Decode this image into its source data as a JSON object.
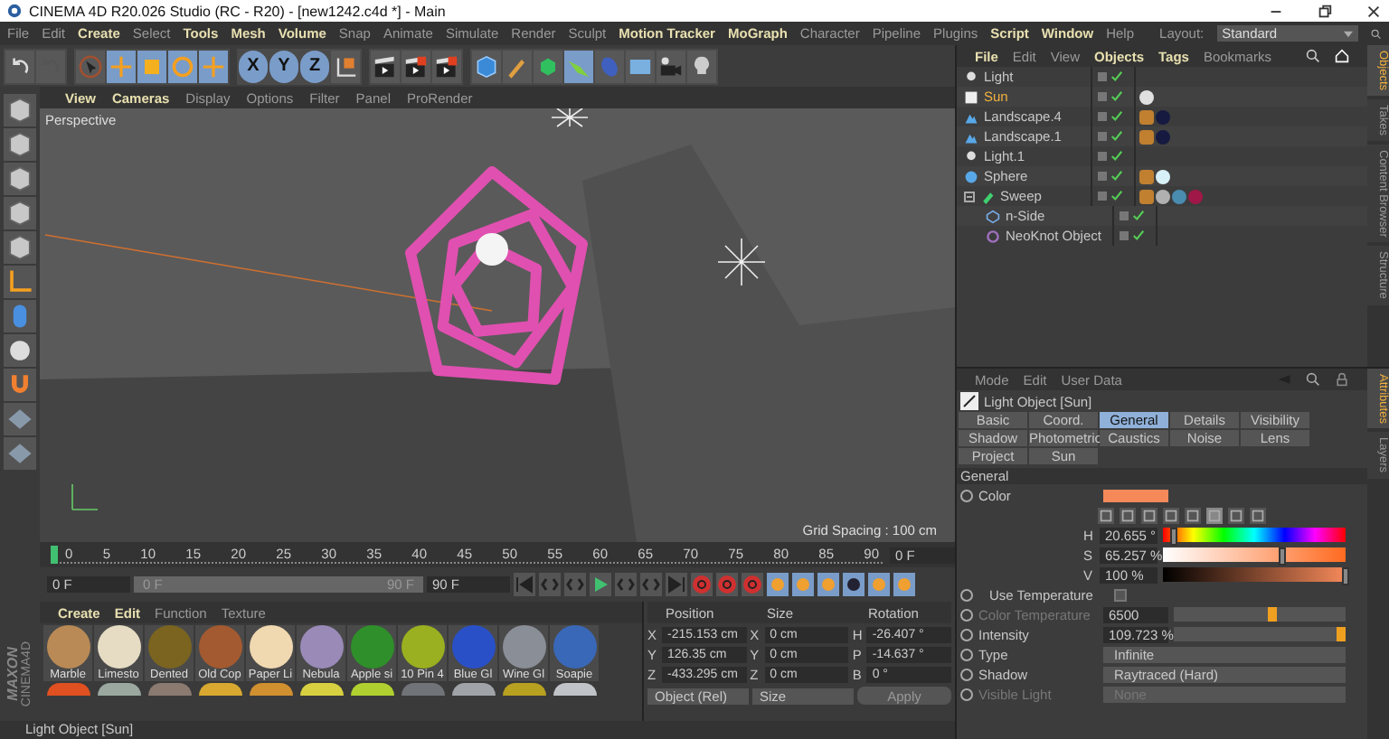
{
  "window": {
    "title": "CINEMA 4D R20.026 Studio (RC - R20) - [new1242.c4d *] - Main"
  },
  "menu": [
    {
      "label": "File",
      "highlighted": false
    },
    {
      "label": "Edit",
      "highlighted": false
    },
    {
      "label": "Create",
      "highlighted": true
    },
    {
      "label": "Select",
      "highlighted": false
    },
    {
      "label": "Tools",
      "highlighted": true
    },
    {
      "label": "Mesh",
      "highlighted": true
    },
    {
      "label": "Volume",
      "highlighted": true
    },
    {
      "label": "Snap",
      "highlighted": false
    },
    {
      "label": "Animate",
      "highlighted": false
    },
    {
      "label": "Simulate",
      "highlighted": false
    },
    {
      "label": "Render",
      "highlighted": false
    },
    {
      "label": "Sculpt",
      "highlighted": false
    },
    {
      "label": "Motion Tracker",
      "highlighted": true
    },
    {
      "label": "MoGraph",
      "highlighted": true
    },
    {
      "label": "Character",
      "highlighted": false
    },
    {
      "label": "Pipeline",
      "highlighted": false
    },
    {
      "label": "Plugins",
      "highlighted": false
    },
    {
      "label": "Script",
      "highlighted": true
    },
    {
      "label": "Window",
      "highlighted": true
    },
    {
      "label": "Help",
      "highlighted": false
    }
  ],
  "layout": {
    "label": "Layout:",
    "value": "Standard"
  },
  "toolbar": {
    "axes": [
      "X",
      "Y",
      "Z"
    ]
  },
  "viewport": {
    "menu": [
      {
        "label": "View",
        "highlighted": true
      },
      {
        "label": "Cameras",
        "highlighted": true
      },
      {
        "label": "Display",
        "highlighted": false
      },
      {
        "label": "Options",
        "highlighted": false
      },
      {
        "label": "Filter",
        "highlighted": false
      },
      {
        "label": "Panel",
        "highlighted": false
      },
      {
        "label": "ProRender",
        "highlighted": false
      }
    ],
    "view_label": "Perspective",
    "grid_spacing": "Grid Spacing : 100 cm"
  },
  "timeline": {
    "ticks": [
      "0",
      "5",
      "10",
      "15",
      "20",
      "25",
      "30",
      "35",
      "40",
      "45",
      "50",
      "55",
      "60",
      "65",
      "70",
      "75",
      "80",
      "85",
      "90"
    ],
    "current_frame": "0 F",
    "range_start": "0 F",
    "slider": {
      "level": 1,
      "start": "0 F",
      "end": "90 F"
    },
    "range_end": "90 F"
  },
  "logo": {
    "line_1": "MAXON",
    "line_2": "CINEMA4D"
  },
  "materials": {
    "menu": [
      {
        "label": "Create",
        "highlighted": true
      },
      {
        "label": "Edit",
        "highlighted": true
      },
      {
        "label": "Function",
        "highlighted": false
      },
      {
        "label": "Texture",
        "highlighted": false
      }
    ],
    "items": [
      {
        "name": "Marble",
        "color": "#b98a55"
      },
      {
        "name": "Limesto",
        "color": "#e6dcc4"
      },
      {
        "name": "Dented",
        "color": "#7a6420"
      },
      {
        "name": "Old Cop",
        "color": "#a45a30"
      },
      {
        "name": "Paper Li",
        "color": "#f0d8b0"
      },
      {
        "name": "Nebula",
        "color": "#9a8ab8"
      },
      {
        "name": "Apple si",
        "color": "#2f8f2a"
      },
      {
        "name": "10 Pin 4",
        "color": "#9ab020"
      },
      {
        "name": "Blue Gl",
        "color": "#2a50c8"
      },
      {
        "name": "Wine Gl",
        "color": "#8a8e96"
      },
      {
        "name": "Soapie",
        "color": "#3a68b8"
      }
    ],
    "row_2": [
      {
        "color": "#e05020"
      },
      {
        "color": "#9aa8a0"
      },
      {
        "color": "#8a7a70"
      },
      {
        "color": "#d8a830"
      },
      {
        "color": "#d09030"
      },
      {
        "color": "#d8d040"
      },
      {
        "color": "#b0d030"
      },
      {
        "color": "#707478"
      },
      {
        "color": "#a0a4a8"
      },
      {
        "color": "#b8a020"
      },
      {
        "color": "#c0c4c8"
      }
    ]
  },
  "coordinates": {
    "headers": [
      "Position",
      "Size",
      "Rotation"
    ],
    "rows": [
      {
        "position_axis": "X",
        "position": "-215.153 cm",
        "size_axis": "X",
        "size": "0 cm",
        "rotation_axis": "H",
        "rotation": "-26.407 °"
      },
      {
        "position_axis": "Y",
        "position": "126.35 cm",
        "size_axis": "Y",
        "size": "0 cm",
        "rotation_axis": "P",
        "rotation": "-14.637 °"
      },
      {
        "position_axis": "Z",
        "position": "-433.295 cm",
        "size_axis": "Z",
        "size": "0 cm",
        "rotation_axis": "B",
        "rotation": "0 °"
      }
    ],
    "mode": "Object (Rel)",
    "size_mode": "Size",
    "apply": "Apply"
  },
  "status_bar": {
    "text": "Light Object [Sun]"
  },
  "objects": {
    "menu": [
      {
        "label": "File",
        "highlighted": true
      },
      {
        "label": "Edit",
        "highlighted": false
      },
      {
        "label": "View",
        "highlighted": false
      },
      {
        "label": "Objects",
        "highlighted": true
      },
      {
        "label": "Tags",
        "highlighted": true
      },
      {
        "label": "Bookmarks",
        "highlighted": false
      }
    ],
    "tree": [
      {
        "name": "Light",
        "kind": "light",
        "selected": false,
        "enabled": true
      },
      {
        "name": "Sun",
        "kind": "sun",
        "selected": true,
        "enabled": true,
        "tags": [
          {
            "kind": "target",
            "color": "#e0e0e0"
          }
        ]
      },
      {
        "name": "Landscape.4",
        "kind": "landscape",
        "selected": false,
        "enabled": true,
        "tags": [
          {
            "kind": "phong",
            "color": "#c08030"
          },
          {
            "kind": "material",
            "color": "#161a40"
          }
        ]
      },
      {
        "name": "Landscape.1",
        "kind": "landscape",
        "selected": false,
        "enabled": true,
        "tags": [
          {
            "kind": "phong",
            "color": "#c08030"
          },
          {
            "kind": "material",
            "color": "#161a40"
          }
        ]
      },
      {
        "name": "Light.1",
        "kind": "light",
        "selected": false,
        "enabled": true
      },
      {
        "name": "Sphere",
        "kind": "sphere",
        "selected": false,
        "enabled": true,
        "tags": [
          {
            "kind": "phong",
            "color": "#c08030"
          },
          {
            "kind": "material",
            "color": "#d8f0f8"
          }
        ]
      },
      {
        "name": "Sweep",
        "kind": "sweep",
        "selected": false,
        "enabled": true,
        "expanded": true,
        "tags": [
          {
            "kind": "phong",
            "color": "#c08030"
          },
          {
            "kind": "material",
            "color": "#b0b0b0"
          },
          {
            "kind": "material",
            "color": "#4a8cb0"
          },
          {
            "kind": "material",
            "color": "#a01848"
          }
        ],
        "children": [
          {
            "name": "n-Side",
            "kind": "spline",
            "selected": false,
            "enabled": true
          },
          {
            "name": "NeoKnot Object",
            "kind": "knot",
            "selected": false,
            "enabled": true
          }
        ]
      }
    ]
  },
  "side_tabs_top": [
    {
      "label": "Objects",
      "selected": true
    },
    {
      "label": "Takes",
      "selected": false
    },
    {
      "label": "Content Browser",
      "selected": false
    },
    {
      "label": "Structure",
      "selected": false
    }
  ],
  "attributes": {
    "menu": [
      {
        "label": "Mode"
      },
      {
        "label": "Edit"
      },
      {
        "label": "User Data"
      }
    ],
    "title": "Light Object [Sun]",
    "tabs": [
      {
        "label": "Basic",
        "selected": false
      },
      {
        "label": "Coord.",
        "selected": false
      },
      {
        "label": "General",
        "selected": true
      },
      {
        "label": "Details",
        "selected": false
      },
      {
        "label": "Visibility",
        "selected": false
      },
      {
        "label": "Shadow",
        "selected": false
      },
      {
        "label": "Photometric",
        "selected": false
      },
      {
        "label": "Caustics",
        "selected": false
      },
      {
        "label": "Noise",
        "selected": false
      },
      {
        "label": "Lens",
        "selected": false
      },
      {
        "label": "Project",
        "selected": false
      },
      {
        "label": "Sun",
        "selected": false
      }
    ],
    "section": "General",
    "params": [
      {
        "kind": "color",
        "label": "Color",
        "color": "#f5895a",
        "channels": [
          {
            "label": "H",
            "value": "20.655 °",
            "level": 0.057
          },
          {
            "label": "S",
            "value": "65.257 %",
            "level": 0.653
          },
          {
            "label": "V",
            "value": "100 %",
            "level": 1
          }
        ]
      },
      {
        "kind": "checkbox",
        "label": "Use Temperature",
        "checked": false,
        "disabled": false
      },
      {
        "kind": "slider",
        "label": "Color Temperature",
        "value": "6500",
        "level": 0.6,
        "disabled": true
      },
      {
        "kind": "slider",
        "label": "Intensity",
        "value": "109.723 %",
        "level": 1,
        "disabled": false
      },
      {
        "kind": "dropdown",
        "label": "Type",
        "value": "Infinite",
        "disabled": false
      },
      {
        "kind": "dropdown",
        "label": "Shadow",
        "value": "Raytraced (Hard)",
        "disabled": false
      },
      {
        "kind": "dropdown",
        "label": "Visible Light",
        "value": "None",
        "disabled": true
      }
    ]
  },
  "side_tabs_bottom": [
    {
      "label": "Attributes",
      "selected": true
    },
    {
      "label": "Layers",
      "selected": false
    }
  ]
}
